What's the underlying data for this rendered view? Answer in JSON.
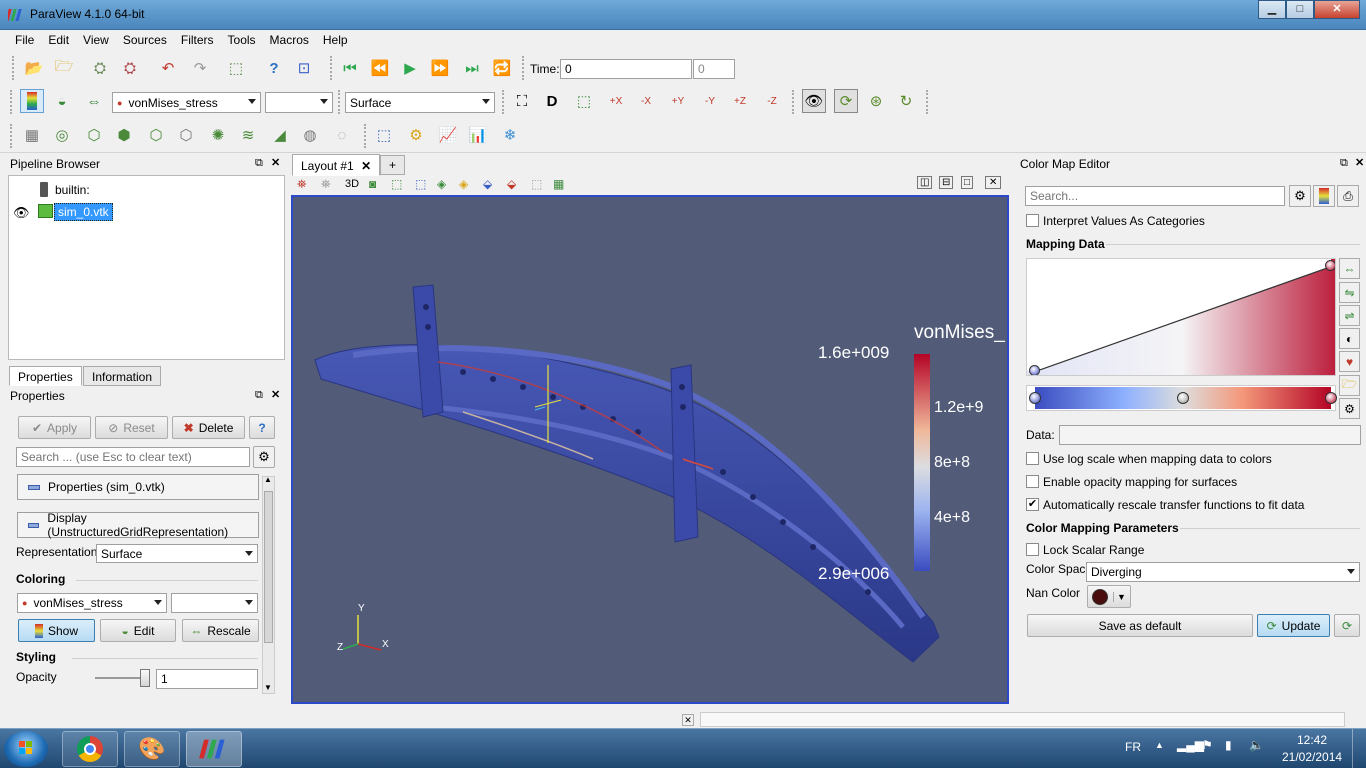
{
  "window": {
    "title": "ParaView 4.1.0 64-bit",
    "controls": [
      "minimize",
      "maximize",
      "close"
    ]
  },
  "menu": [
    "File",
    "Edit",
    "View",
    "Sources",
    "Filters",
    "Tools",
    "Macros",
    "Help"
  ],
  "toolbar": {
    "time_label": "Time:",
    "time_value": "0",
    "timestep_value": "0",
    "array_select": "vonMises_stress",
    "component_select": "",
    "representation_select": "Surface",
    "camera_labels": [
      "+X",
      "-X",
      "+Y",
      "-Y",
      "+Z",
      "-Z"
    ]
  },
  "pipeline_browser": {
    "title": "Pipeline Browser",
    "items": [
      {
        "label": "builtin:",
        "icon": "server-icon"
      },
      {
        "label": "sim_0.vtk",
        "icon": "unstructured-grid-icon",
        "selected": true,
        "visible": true
      }
    ]
  },
  "properties": {
    "tabs": [
      "Properties",
      "Information"
    ],
    "panel_title": "Properties",
    "buttons": {
      "apply": "Apply",
      "reset": "Reset",
      "delete": "Delete",
      "help": "?"
    },
    "search_placeholder": "Search ... (use Esc to clear text)",
    "sections": {
      "properties_group": "Properties (sim_0.vtk)",
      "display_group": "Display (UnstructuredGridRepresentation)"
    },
    "representation_label": "Representation",
    "representation_value": "Surface",
    "coloring_label": "Coloring",
    "coloring_array": "vonMises_stress",
    "coloring_component": "",
    "coloring_buttons": {
      "show": "Show",
      "edit": "Edit",
      "rescale": "Rescale"
    },
    "styling_label": "Styling",
    "opacity_label": "Opacity",
    "opacity_value": "1",
    "opacity_level": 1.0
  },
  "layout": {
    "tab_label": "Layout #1",
    "add_tab": "+",
    "view_mode": "3D"
  },
  "render": {
    "scalar_bar": {
      "title": "vonMises_",
      "max": "1.6e+009",
      "min": "2.9e+006",
      "ticks": [
        "1.2e+9",
        "8e+8",
        "4e+8"
      ]
    },
    "axes": {
      "x": "X",
      "y": "Y",
      "z": "Z"
    }
  },
  "color_map_editor": {
    "title": "Color Map Editor",
    "search_placeholder": "Search...",
    "interpret_categories": {
      "label": "Interpret Values As Categories",
      "checked": false
    },
    "mapping_data_label": "Mapping Data",
    "data_label": "Data:",
    "data_value": "",
    "log_scale": {
      "label": "Use log scale when mapping data to colors",
      "checked": false
    },
    "opacity_mapping": {
      "label": "Enable opacity mapping for surfaces",
      "checked": false
    },
    "auto_rescale": {
      "label": "Automatically rescale transfer functions to fit data",
      "checked": true
    },
    "params_label": "Color Mapping Parameters",
    "lock_range": {
      "label": "Lock Scalar Range",
      "checked": false
    },
    "color_space_label": "Color Space",
    "color_space_value": "Diverging",
    "nan_color_label": "Nan Color",
    "nan_color": "#4a0e0e",
    "save_default": "Save as default",
    "update": "Update"
  },
  "taskbar": {
    "language": "FR",
    "time": "12:42",
    "date": "21/02/2014"
  },
  "colors": {
    "viewport_bg": "#525c78",
    "diverging_low": "#3b4cc0",
    "diverging_high": "#b40426"
  }
}
